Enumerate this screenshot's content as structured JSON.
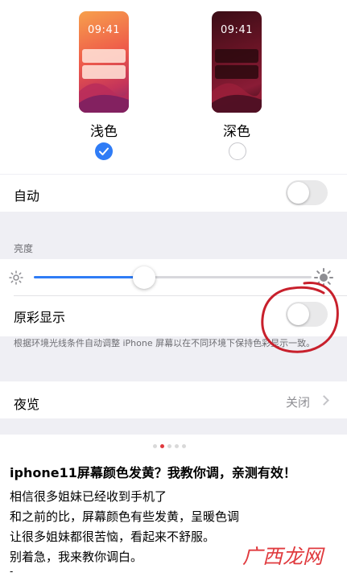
{
  "appearance": {
    "preview_time": "09:41",
    "light_label": "浅色",
    "dark_label": "深色",
    "selected": "light"
  },
  "auto_row": {
    "label": "自动",
    "toggle_on": false
  },
  "brightness": {
    "header": "亮度",
    "level": 0.36
  },
  "true_tone": {
    "label": "原彩显示",
    "toggle_on": false,
    "footer": "根据环境光线条件自动调整 iPhone 屏幕以在不同环境下保持色彩显示一致。"
  },
  "night_shift": {
    "label": "夜览",
    "value": "关闭"
  },
  "carousel": {
    "count": 5,
    "active_index": 1
  },
  "article": {
    "title": "iphone11屏幕颜色发黄？我教你调，亲测有效！",
    "lines": [
      "相信很多姐妹已经收到手机了",
      "和之前的比，屏幕颜色有些发黄，呈暖色调",
      "让很多姐妹都很苦恼，看起来不舒服。",
      "别着急，我来教你调白。"
    ],
    "trailing": "-"
  },
  "watermark": "广西龙网",
  "colors": {
    "accent": "#2f7cf6",
    "annotation": "#c8202c",
    "watermark": "#e03a3e"
  }
}
